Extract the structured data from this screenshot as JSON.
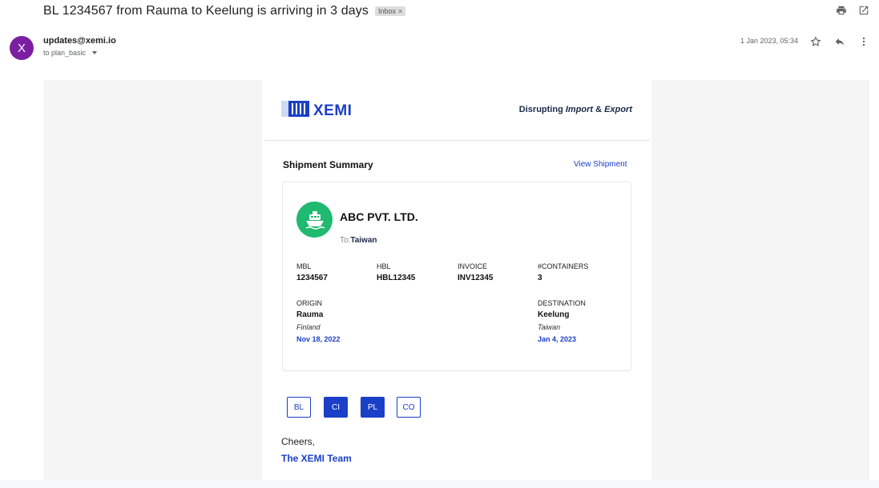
{
  "email": {
    "subject": "BL 1234567 from Rauma to Keelung is arriving in 3 days",
    "label": "Inbox",
    "label_close": "×",
    "sender": "updates@xemi.io",
    "avatar_letter": "X",
    "to": "to plan_basic",
    "date": "1 Jan 2023, 05:34"
  },
  "body": {
    "logo_text": "XEMI",
    "tagline_prefix": "Disrupting ",
    "tagline_import": "Import",
    "tagline_amp": " & ",
    "tagline_export": "Export",
    "summary_title": "Shipment Summary",
    "view_shipment": "View Shipment",
    "company": "ABC PVT. LTD.",
    "to_label": "To:",
    "to_value": "Taiwan",
    "fields": {
      "mbl_label": "MBL",
      "mbl_value": "1234567",
      "hbl_label": "HBL",
      "hbl_value": "HBL12345",
      "invoice_label": "INVOICE",
      "invoice_value": "INV12345",
      "containers_label": "#CONTAINERS",
      "containers_value": "3"
    },
    "origin": {
      "label": "ORIGIN",
      "city": "Rauma",
      "country": "Finland",
      "date": "Nov 18, 2022"
    },
    "destination": {
      "label": "DESTINATION",
      "city": "Keelung",
      "country": "Taiwan",
      "date": "Jan 4, 2023"
    },
    "docs": [
      "BL",
      "CI",
      "PL",
      "CO"
    ],
    "cheers": "Cheers,",
    "team": "The XEMI Team"
  },
  "colors": {
    "brand": "#1a3fc8",
    "ship_icon_bg": "#1fb96f",
    "avatar_bg": "#7b1fa2"
  }
}
